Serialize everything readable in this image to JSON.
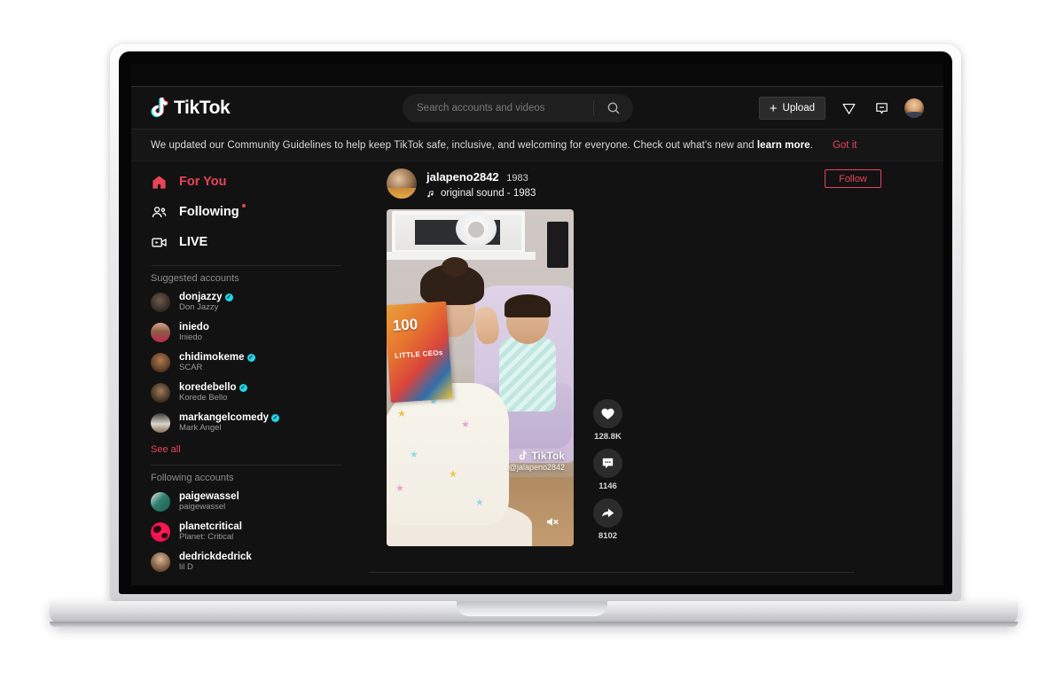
{
  "header": {
    "logo_text": "TikTok",
    "logo_icon": "tiktok-note-icon",
    "search_placeholder": "Search accounts and videos",
    "search_value": "",
    "search_icon": "search-icon",
    "upload_label": "Upload",
    "upload_plus": "+",
    "send_icon": "paper-plane-icon",
    "message_icon": "message-icon",
    "avatar_icon": "user-avatar"
  },
  "banner": {
    "text_part1": "We updated our Community Guidelines to help keep TikTok safe, inclusive, and welcoming for everyone. Check out what's new and ",
    "link_text": "learn more",
    "text_part2": ".",
    "dismiss_label": "Got it"
  },
  "sidebar": {
    "nav": [
      {
        "label": "For You",
        "icon": "home-icon",
        "active": true,
        "dot": false
      },
      {
        "label": "Following",
        "icon": "people-icon",
        "active": false,
        "dot": true
      },
      {
        "label": "LIVE",
        "icon": "live-video-icon",
        "active": false,
        "dot": false
      }
    ],
    "suggested_title": "Suggested accounts",
    "suggested": [
      {
        "handle": "donjazzy",
        "name": "Don Jazzy",
        "verified": true
      },
      {
        "handle": "iniedo",
        "name": "Iniedo",
        "verified": false
      },
      {
        "handle": "chidimokeme",
        "name": "SCAR",
        "verified": true
      },
      {
        "handle": "koredebello",
        "name": "Korede Bello",
        "verified": true
      },
      {
        "handle": "markangelcomedy",
        "name": "Mark Angel",
        "verified": true
      }
    ],
    "see_all_label": "See all",
    "following_title": "Following accounts",
    "following": [
      {
        "handle": "paigewassel",
        "name": "paigewassel",
        "verified": false
      },
      {
        "handle": "planetcritical",
        "name": "Planet: Critical",
        "verified": false
      },
      {
        "handle": "dedrickdedrick",
        "name": "lil D",
        "verified": false
      }
    ]
  },
  "post": {
    "username": "jalapeno2842",
    "nickname": "1983",
    "sound_icon": "music-note-icon",
    "sound_label": "original sound - 1983",
    "follow_label": "Follow",
    "watermark_brand": "TikTok",
    "watermark_handle": "@jalapeno2842",
    "mute_icon": "speaker-muted-icon",
    "book_number": "100",
    "book_title": "LITTLE CEOs",
    "actions": [
      {
        "icon": "heart-icon",
        "count": "128.8K",
        "name": "like-button"
      },
      {
        "icon": "comment-icon",
        "count": "1146",
        "name": "comment-button"
      },
      {
        "icon": "share-icon",
        "count": "8102",
        "name": "share-button"
      }
    ]
  },
  "colors": {
    "accent_red": "#e8445a",
    "verified_blue": "#20d5ec",
    "app_bg": "#121212"
  }
}
